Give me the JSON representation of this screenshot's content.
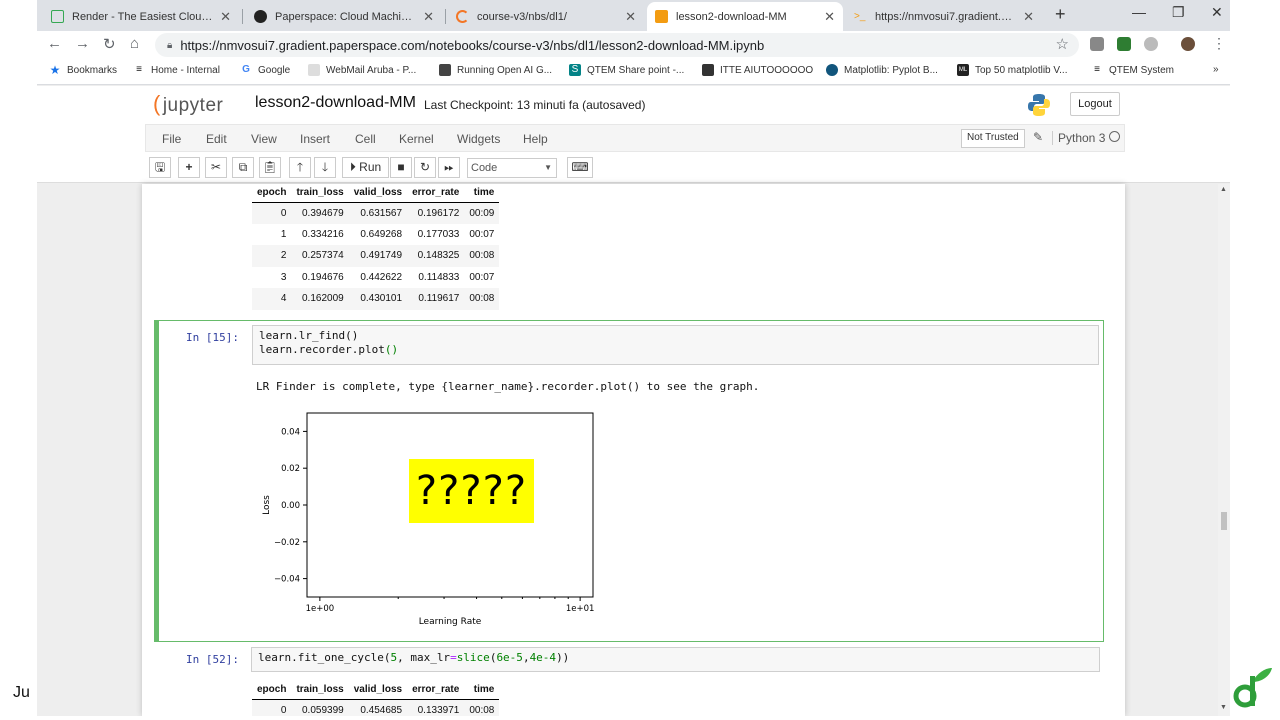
{
  "browser": {
    "tabs": [
      {
        "title": "Render - The Easiest Cloud For All",
        "color": "#35a853"
      },
      {
        "title": "Paperspace: Cloud Machine Learning",
        "color": "#222222"
      },
      {
        "title": "course-v3/nbs/dl1/",
        "color": "#f37626"
      },
      {
        "title": "lesson2-download-MM",
        "color": "#f39c12"
      },
      {
        "title": "https://nmvosui7.gradient.paperspace",
        "color": "#f39c12"
      }
    ],
    "url": "https://nmvosui7.gradient.paperspace.com/notebooks/course-v3/nbs/dl1/lesson2-download-MM.ipynb",
    "bookmarks": [
      {
        "label": "Bookmarks",
        "icon": "star-icon"
      },
      {
        "label": "Home - Internal",
        "icon": "stack-icon"
      },
      {
        "label": "Google",
        "icon": "google-icon"
      },
      {
        "label": "WebMail Aruba - P...",
        "icon": "mail-icon"
      },
      {
        "label": "Running Open AI G...",
        "icon": "page-icon"
      },
      {
        "label": "QTEM Share point -...",
        "icon": "sharepoint-icon"
      },
      {
        "label": "ITTE AIUTOOOOOO",
        "icon": "folder-icon"
      },
      {
        "label": "Matplotlib: Pyplot B...",
        "icon": "matplotlib-icon"
      },
      {
        "label": "Top 50 matplotlib V...",
        "icon": "ml-icon"
      },
      {
        "label": "QTEM System",
        "icon": "stack-icon"
      }
    ],
    "more_bookmarks": "»"
  },
  "jupyter": {
    "logo_text": "jupyter",
    "notebook_name": "lesson2-download-MM",
    "checkpoint": "Last Checkpoint: 13 minuti fa  (autosaved)",
    "logout_label": "Logout",
    "menu": [
      "File",
      "Edit",
      "View",
      "Insert",
      "Cell",
      "Kernel",
      "Widgets",
      "Help"
    ],
    "trusted_label": "Not Trusted",
    "kernel_name": "Python 3",
    "run_label": "Run",
    "cell_type": "Code"
  },
  "table1": {
    "headers": [
      "epoch",
      "train_loss",
      "valid_loss",
      "error_rate",
      "time"
    ],
    "rows": [
      [
        "0",
        "0.394679",
        "0.631567",
        "0.196172",
        "00:09"
      ],
      [
        "1",
        "0.334216",
        "0.649268",
        "0.177033",
        "00:07"
      ],
      [
        "2",
        "0.257374",
        "0.491749",
        "0.148325",
        "00:08"
      ],
      [
        "3",
        "0.194676",
        "0.442622",
        "0.114833",
        "00:07"
      ],
      [
        "4",
        "0.162009",
        "0.430101",
        "0.119617",
        "00:08"
      ]
    ]
  },
  "cell15": {
    "prompt": "In [15]:",
    "line1": "learn.lr_find()",
    "line2_main": "learn.recorder.plot",
    "line2_paren": "()",
    "output": "LR Finder is complete, type {learner_name}.recorder.plot() to see the graph.",
    "overlay_text": "?????"
  },
  "cell52": {
    "prompt": "In [52]:",
    "code_a": "learn.fit_one_cycle(",
    "code_num5": "5",
    "code_b": ", max_lr",
    "code_eq": "=",
    "code_slice": "slice",
    "code_c": "(",
    "code_n1": "6e-5",
    "code_d": ",",
    "code_n2": "4e-4",
    "code_e": "))"
  },
  "table2": {
    "headers": [
      "epoch",
      "train_loss",
      "valid_loss",
      "error_rate",
      "time"
    ],
    "rows": [
      [
        "0",
        "0.059399",
        "0.454685",
        "0.133971",
        "00:08"
      ]
    ]
  },
  "chart_data": {
    "type": "line",
    "title": "",
    "xlabel": "Learning Rate",
    "ylabel": "Loss",
    "x_scale": "log",
    "x_ticks": [
      "1e+00",
      "1e+01"
    ],
    "y_ticks": [
      "0.04",
      "0.02",
      "0.00",
      "−0.02",
      "−0.04"
    ],
    "ylim": [
      -0.05,
      0.05
    ],
    "series": []
  },
  "footer": {
    "left_text": "Ju"
  }
}
